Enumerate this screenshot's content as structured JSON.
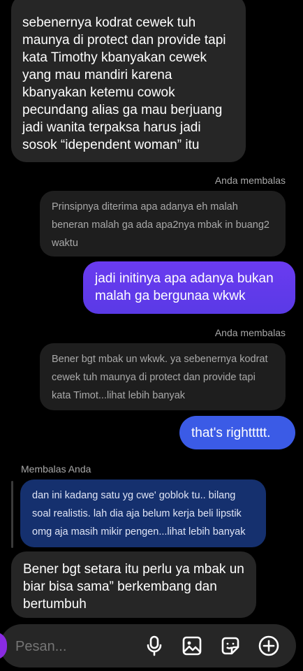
{
  "messages": {
    "top_received": "sebenernya kodrat cewek tuh maunya di protect dan provide tapi kata Timothy kbanyakan cewek yang mau mandiri karena kbanyakan ketemu cowok pecundang alias ga mau berjuang jadi wanita terpaksa harus jadi sosok “idependent woman” itu",
    "reply_label_1": "Anda membalas",
    "quote_1": "Prinsipnya diterima apa adanya eh malah beneran malah ga ada apa2nya mbak in buang2 waktu",
    "sent_1": "jadi initinya apa adanya bukan malah ga bergunaa wkwk",
    "reply_label_2": "Anda membalas",
    "quote_2": "Bener bgt mbak un wkwk. ya sebenernya kodrat cewek tuh maunya di protect dan provide tapi kata Timot...lihat lebih banyak",
    "sent_2": "that's righttttt.",
    "reply_label_3": "Membalas Anda",
    "quote_3": "dan ini kadang satu yg cwe' goblok tu.. bilang soal realistis. lah dia aja belum kerja beli lipstik omg aja masih mikir pengen...lihat lebih banyak",
    "bottom_received": "Bener bgt setara itu perlu ya mbak un biar bisa sama” berkembang dan bertumbuh"
  },
  "composer": {
    "placeholder": "Pesan...",
    "icons": [
      "microphone-icon",
      "gallery-icon",
      "sticker-icon",
      "plus-icon"
    ]
  },
  "colors": {
    "background": "#000000",
    "received_bubble": "#262626",
    "sent_purple": "#5a3ae6",
    "sent_blue": "#3b5be6",
    "quote_blue": "#15306e"
  }
}
